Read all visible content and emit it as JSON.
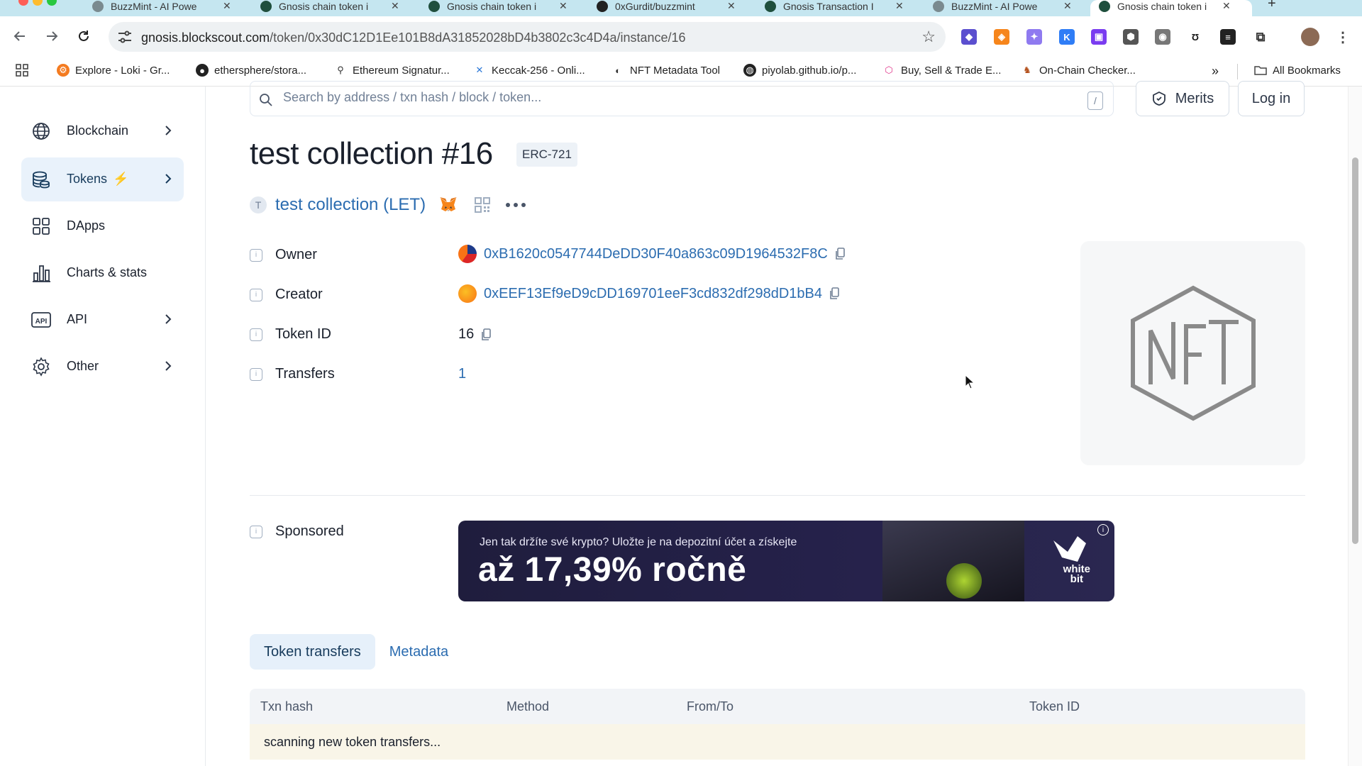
{
  "browser": {
    "tabs": [
      {
        "label": "BuzzMint - AI Powe",
        "active": false
      },
      {
        "label": "Gnosis chain token i",
        "active": false
      },
      {
        "label": "Gnosis chain token i",
        "active": false
      },
      {
        "label": "0xGurdit/buzzmint",
        "active": false
      },
      {
        "label": "Gnosis Transaction I",
        "active": false
      },
      {
        "label": "BuzzMint - AI Powe",
        "active": false
      },
      {
        "label": "Gnosis chain token i",
        "active": true
      }
    ],
    "url_host": "gnosis.blockscout.com",
    "url_path": "/token/0x30dC12D1Ee101B8dA31852028bD4b3802c3c4D4a/instance/16",
    "bookmarks": [
      "Explore - Loki - Gr...",
      "ethersphere/stora...",
      "Ethereum Signatur...",
      "Keccak-256 - Onli...",
      "NFT Metadata Tool",
      "piyolab.github.io/p...",
      "Buy, Sell & Trade E...",
      "On-Chain Checker..."
    ],
    "all_bookmarks": "All Bookmarks"
  },
  "sidebar": {
    "items": [
      {
        "label": "Blockchain",
        "icon": "globe-icon"
      },
      {
        "label": "Tokens",
        "icon": "coins-icon"
      },
      {
        "label": "DApps",
        "icon": "grid-icon"
      },
      {
        "label": "Charts & stats",
        "icon": "bar-chart-icon"
      },
      {
        "label": "API",
        "icon": "api-icon"
      },
      {
        "label": "Other",
        "icon": "gear-icon"
      }
    ]
  },
  "header": {
    "search_placeholder": "Search by address / txn hash / block / token...",
    "slash_key": "/",
    "merits_label": "Merits",
    "login_label": "Log in"
  },
  "token": {
    "title": "test collection #16",
    "standard": "ERC-721",
    "collection_initial": "T",
    "collection_name": "test collection (LET)"
  },
  "details": {
    "owner_label": "Owner",
    "owner_value": "0xB1620c0547744DeDD30F40a863c09D1964532F8C",
    "creator_label": "Creator",
    "creator_value": "0xEEF13Ef9eD9cDD169701eeF3cd832df298dD1bB4",
    "token_id_label": "Token ID",
    "token_id_value": "16",
    "transfers_label": "Transfers",
    "transfers_value": "1",
    "sponsored_label": "Sponsored"
  },
  "ad": {
    "line1": "Jen tak držíte své krypto? Uložte je na depozitní účet a získejte",
    "line2": "až 17,39% ročně",
    "brand_top": "white",
    "brand_bottom": "bit"
  },
  "tabs": {
    "transfers": "Token transfers",
    "metadata": "Metadata"
  },
  "table": {
    "headers": [
      "Txn hash",
      "Method",
      "From/To",
      "Token ID"
    ],
    "status_row": "scanning new token transfers..."
  },
  "colors": {
    "link": "#2b6cb0",
    "accent_bolt": "#f26a1b",
    "active_nav_bg": "#e9f2fb",
    "tabstrip": "#c5e6f0"
  }
}
